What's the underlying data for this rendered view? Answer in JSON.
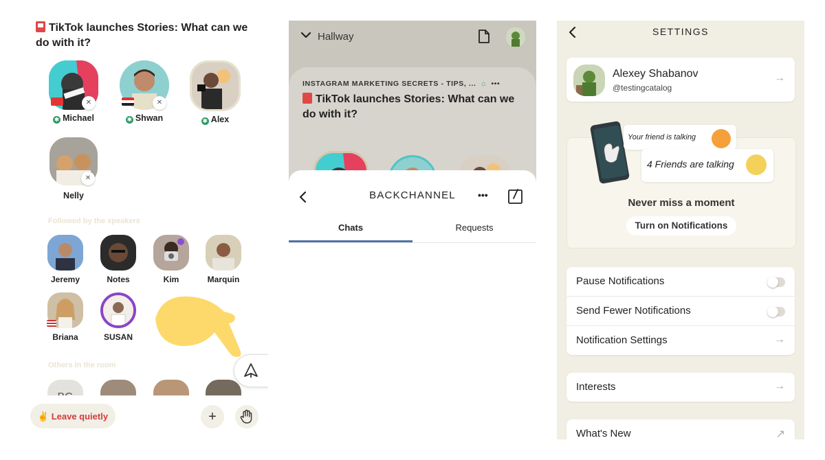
{
  "room": {
    "title": "TikTok launches Stories: What can we do with it?",
    "speakers": [
      {
        "name": "Michael",
        "moderator": true,
        "flag": "ch"
      },
      {
        "name": "Shwan",
        "moderator": true,
        "flag": "iq"
      },
      {
        "name": "Alex",
        "moderator": true,
        "flag": ""
      },
      {
        "name": "Nelly",
        "moderator": false,
        "flag": ""
      }
    ],
    "followed_label": "Followed by the speakers",
    "followed": [
      {
        "name": "Jeremy"
      },
      {
        "name": "Notes"
      },
      {
        "name": "Kim"
      },
      {
        "name": "Marquin"
      },
      {
        "name": "Briana"
      },
      {
        "name": "SUSAN"
      }
    ],
    "others_label": "Others in the room",
    "others_initials": "BG",
    "leave_label": "✌️ Leave quietly",
    "add_icon": "+",
    "hand_icon": "raise-hand-icon"
  },
  "backchannel": {
    "hallway_label": "Hallway",
    "club_line": "INSTAGRAM MARKETING SECRETS - TIPS, ...",
    "card_title": "TikTok launches Stories: What can we do with it?",
    "title": "BACKCHANNEL",
    "more": "•••",
    "tabs": [
      {
        "label": "Chats",
        "active": true
      },
      {
        "label": "Requests",
        "active": false
      }
    ]
  },
  "settings": {
    "title": "SETTINGS",
    "profile": {
      "name": "Alexey Shabanov",
      "handle": "@testingcatalog"
    },
    "bubble1": "Your friend is talking",
    "bubble2": "4 Friends are talking",
    "never_miss": "Never miss a moment",
    "turn_on": "Turn on Notifications",
    "notif_rows": [
      {
        "label": "Pause Notifications",
        "type": "toggle",
        "on": false
      },
      {
        "label": "Send Fewer Notifications",
        "type": "toggle",
        "on": false
      },
      {
        "label": "Notification Settings",
        "type": "arrow"
      }
    ],
    "interests": "Interests",
    "whats_new": "What's New",
    "arrow": "→",
    "external_arrow": "↗"
  },
  "colors": {
    "accent_blue": "#4f71a6",
    "leave_red": "#d23b3b",
    "moderator_green": "#2e9a63",
    "settings_bg": "#f1efe4",
    "cursor_yellow": "#fcd96a"
  }
}
